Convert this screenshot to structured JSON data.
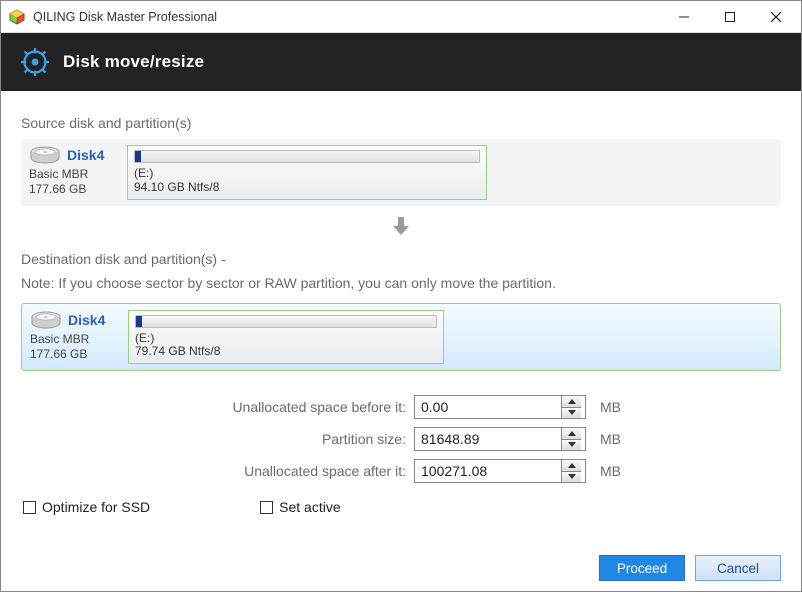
{
  "window": {
    "title": "QILING Disk Master Professional"
  },
  "header": {
    "title": "Disk move/resize"
  },
  "labels": {
    "source": "Source disk and partition(s)",
    "destination": "Destination disk and partition(s) -",
    "note": "Note: If you choose sector by sector or RAW partition, you can only move the partition.",
    "before": "Unallocated space before it:",
    "size": "Partition size:",
    "after": "Unallocated space after it:",
    "unit": "MB",
    "optimize_ssd": "Optimize for SSD",
    "set_active": "Set active"
  },
  "source_disk": {
    "name": "Disk4",
    "type": "Basic MBR",
    "capacity": "177.66 GB",
    "partition": {
      "letter": "(E:)",
      "desc": "94.10 GB Ntfs/8"
    }
  },
  "dest_disk": {
    "name": "Disk4",
    "type": "Basic MBR",
    "capacity": "177.66 GB",
    "partition": {
      "letter": "(E:)",
      "desc": "79.74 GB Ntfs/8"
    }
  },
  "values": {
    "before": "0.00",
    "size": "81648.89",
    "after": "100271.08"
  },
  "buttons": {
    "proceed": "Proceed",
    "cancel": "Cancel"
  }
}
